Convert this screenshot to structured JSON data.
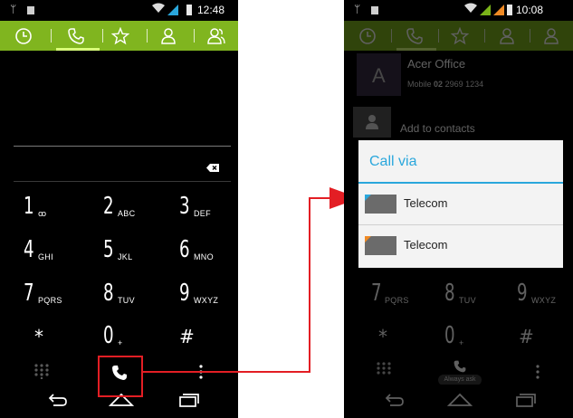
{
  "left": {
    "status_time": "12:48",
    "keypad": [
      {
        "digit": "1",
        "letters": "ꝏ"
      },
      {
        "digit": "2",
        "letters": "ABC"
      },
      {
        "digit": "3",
        "letters": "DEF"
      },
      {
        "digit": "4",
        "letters": "GHI"
      },
      {
        "digit": "5",
        "letters": "JKL"
      },
      {
        "digit": "6",
        "letters": "MNO"
      },
      {
        "digit": "7",
        "letters": "PQRS"
      },
      {
        "digit": "8",
        "letters": "TUV"
      },
      {
        "digit": "9",
        "letters": "WXYZ"
      },
      {
        "digit": "*",
        "letters": ""
      },
      {
        "digit": "0",
        "letters": "+"
      },
      {
        "digit": "#",
        "letters": ""
      }
    ]
  },
  "right": {
    "status_time": "10:08",
    "contact": {
      "name": "Acer Office",
      "label": "Mobile",
      "number_prefix": "02",
      "number": "2969 1234",
      "avatar_letter": "A"
    },
    "add_to_contacts": "Add to contacts",
    "dialog": {
      "title": "Call via",
      "options": [
        {
          "label": "Telecom",
          "corner_color": "#2aa7dc"
        },
        {
          "label": "Telecom",
          "corner_color": "#f08a24"
        }
      ]
    },
    "keypad": [
      {
        "digit": "7",
        "letters": "PQRS"
      },
      {
        "digit": "8",
        "letters": "TUV"
      },
      {
        "digit": "9",
        "letters": "WXYZ"
      },
      {
        "digit": "*",
        "letters": ""
      },
      {
        "digit": "0",
        "letters": "+"
      },
      {
        "digit": "#",
        "letters": ""
      }
    ],
    "always_ask": "Always ask"
  },
  "colors": {
    "tab_green": "#80b51f",
    "accent_blue": "#2aa7dc",
    "highlight_red": "#e31e24"
  },
  "icons": [
    "usb-icon",
    "wifi-icon",
    "signal-icon",
    "battery-icon",
    "clock-icon",
    "phone-icon",
    "star-icon",
    "person-icon",
    "group-icon",
    "backspace-icon",
    "dialpad-icon",
    "call-icon",
    "overflow-icon",
    "back-icon",
    "home-icon",
    "recents-icon"
  ]
}
